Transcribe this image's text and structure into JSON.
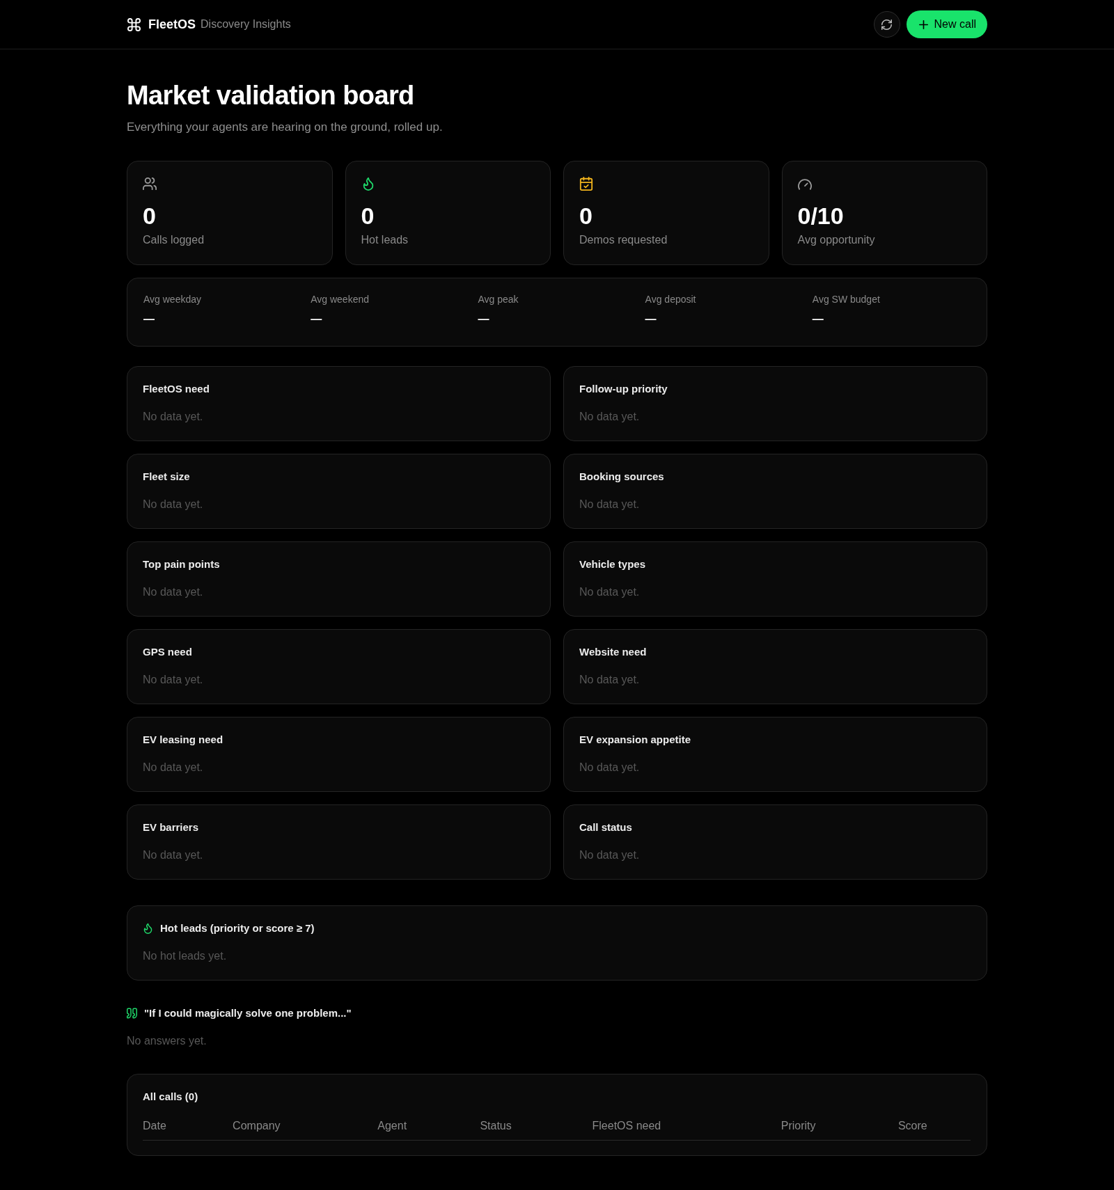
{
  "header": {
    "brand": "FleetOS",
    "section": "Discovery Insights",
    "new_call_button": {
      "label": "New call"
    }
  },
  "title": "Market validation board",
  "subtitle": "Everything your agents are hearing on the ground, rolled up.",
  "stats": [
    {
      "kind": "people",
      "value": "0",
      "label": "Calls logged"
    },
    {
      "kind": "flame",
      "value": "0",
      "label": "Hot leads"
    },
    {
      "kind": "calendar",
      "value": "0",
      "label": "Demos requested"
    },
    {
      "kind": "gauge",
      "value": "0/10",
      "label": "Avg opportunity"
    }
  ],
  "averages": [
    {
      "label": "Avg weekday",
      "value": "—"
    },
    {
      "label": "Avg weekend",
      "value": "—"
    },
    {
      "label": "Avg peak",
      "value": "—"
    },
    {
      "label": "Avg deposit",
      "value": "—"
    },
    {
      "label": "Avg SW budget",
      "value": "—"
    }
  ],
  "breakdowns": [
    {
      "title": "FleetOS need",
      "empty_text": "No data yet."
    },
    {
      "title": "Follow-up priority",
      "empty_text": "No data yet."
    },
    {
      "title": "Fleet size",
      "empty_text": "No data yet."
    },
    {
      "title": "Booking sources",
      "empty_text": "No data yet."
    },
    {
      "title": "Top pain points",
      "empty_text": "No data yet."
    },
    {
      "title": "Vehicle types",
      "empty_text": "No data yet."
    },
    {
      "title": "GPS need",
      "empty_text": "No data yet."
    },
    {
      "title": "Website need",
      "empty_text": "No data yet."
    },
    {
      "title": "EV leasing need",
      "empty_text": "No data yet."
    },
    {
      "title": "EV expansion appetite",
      "empty_text": "No data yet."
    },
    {
      "title": "EV barriers",
      "empty_text": "No data yet."
    },
    {
      "title": "Call status",
      "empty_text": "No data yet."
    }
  ],
  "hot_leads": {
    "title": "Hot leads (priority or score ≥ 7)",
    "empty_text": "No hot leads yet."
  },
  "magic_question": {
    "title": "\"If I could magically solve one problem...\"",
    "empty_text": "No answers yet."
  },
  "calls_table": {
    "title": "All calls (0)",
    "columns": [
      "Date",
      "Company",
      "Agent",
      "Status",
      "FleetOS need",
      "Priority",
      "Score"
    ]
  }
}
